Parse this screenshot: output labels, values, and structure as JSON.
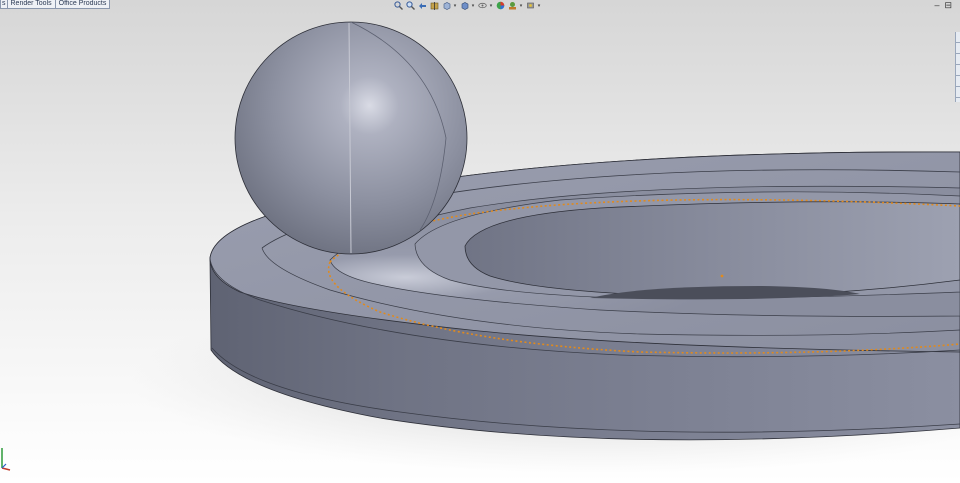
{
  "command_tabs": [
    {
      "label": "s"
    },
    {
      "label": "Render Tools"
    },
    {
      "label": "Office Products"
    }
  ],
  "heads_up_toolbar": {
    "icons": [
      "zoom-to-fit-icon",
      "zoom-to-area-icon",
      "previous-view-icon",
      "section-view-icon",
      "view-orientation-icon",
      "display-style-icon",
      "hide-show-items-icon",
      "edit-appearance-icon",
      "apply-scene-icon",
      "view-settings-icon"
    ]
  },
  "window_controls": {
    "minimize": "–",
    "restore": "⊟"
  },
  "colors": {
    "part_body": "#8a8e9e",
    "part_highlight": "#b9bccb",
    "part_shadow": "#5d6170",
    "selection_edge": "#e08a1e"
  }
}
